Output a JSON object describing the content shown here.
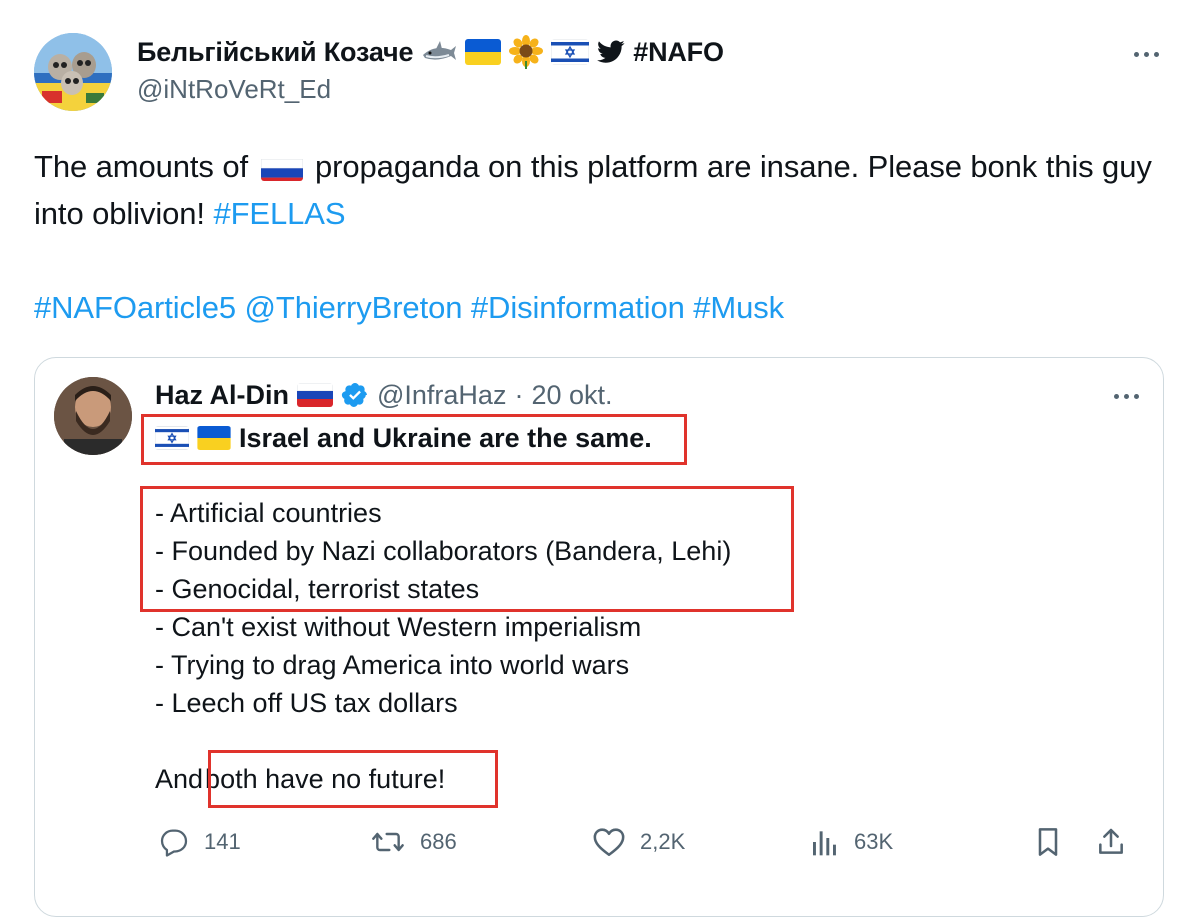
{
  "tweet": {
    "display_name": "Бельгійський Козаче",
    "name_emojis": "🦈",
    "name_hashtag": "#NAFO",
    "handle": "@iNtRoVeRt_Ed",
    "text_part1": "The amounts of",
    "text_part2": "propaganda on this platform are insane. Please bonk this guy into oblivion!",
    "hashtag_fellas": "#FELLAS",
    "hashtag_article5": "#NAFOarticle5",
    "mention": "@ThierryBreton",
    "hashtag_disinfo": "#Disinformation",
    "hashtag_musk": "#Musk"
  },
  "quote": {
    "display_name": "Haz Al-Din",
    "handle": "@InfraHaz",
    "separator": "·",
    "date": "20 okt.",
    "headline": "Israel and Ukraine are the same.",
    "lines": [
      "- Artificial countries",
      "- Founded by Nazi collaborators (Bandera, Lehi)",
      "- Genocidal, terrorist states",
      "- Can't exist without Western imperialism",
      "- Trying to drag America into world wars",
      "- Leech off US tax dollars"
    ],
    "closing_prefix": "And",
    "closing_highlight": "both have no future!",
    "actions": {
      "replies": "141",
      "reposts": "686",
      "likes": "2,2K",
      "views": "63K"
    }
  },
  "colors": {
    "accent_link": "#1d9bf0",
    "secondary_text": "#536471",
    "highlight_box": "#e0332c",
    "border": "#cfd9de"
  }
}
